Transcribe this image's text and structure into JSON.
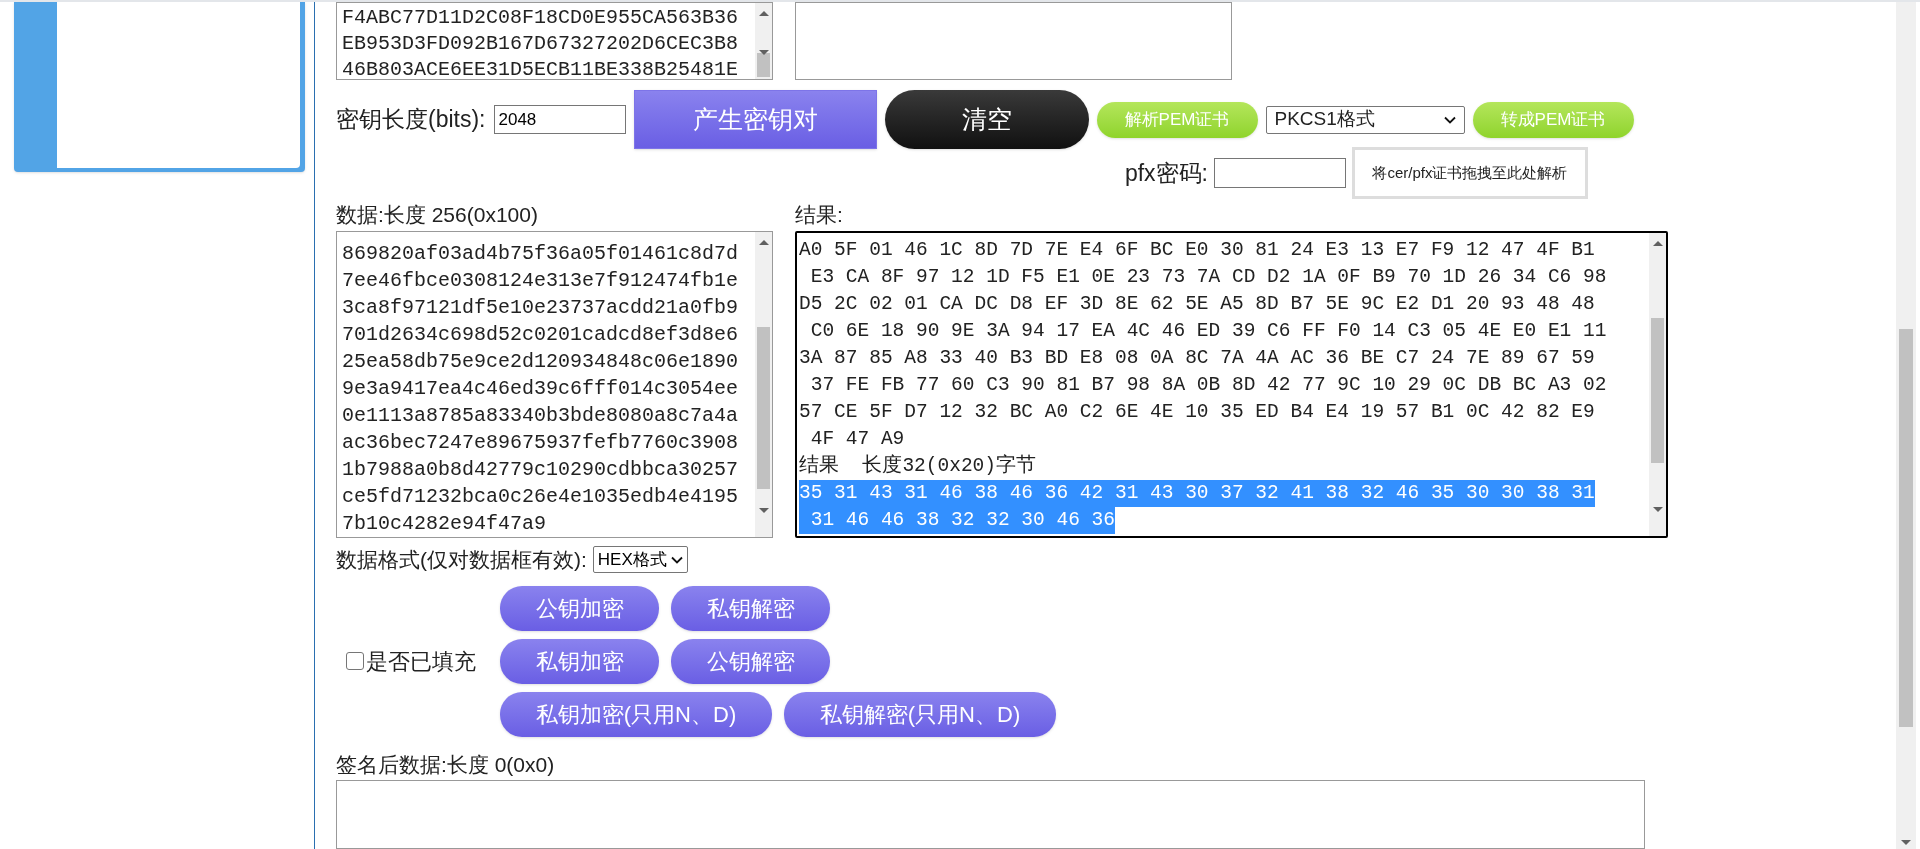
{
  "key_box": {
    "lines": [
      "F4ABC77D11D2C08F18CD0E955CA563B36",
      "EB953D3FD092B167D67327202D6CEC3B8",
      "46B803ACE6EE31D5ECB11BE338B25481E"
    ]
  },
  "key_length": {
    "label": "密钥长度(bits):",
    "value": "2048"
  },
  "toolbar": [
    {
      "kind": "purple",
      "label": "产生密钥对"
    },
    {
      "kind": "dark",
      "label": "清空"
    },
    {
      "kind": "green",
      "label": "解析PEM证书"
    },
    {
      "kind": "select",
      "label": "PKCS1格式"
    },
    {
      "kind": "green",
      "label": "转成PEM证书"
    }
  ],
  "pfx": {
    "label": "pfx密码:",
    "drop_hint": "将cer/pfx证书拖拽至此处解析"
  },
  "data": {
    "label": "数据:长度 256(0x100)",
    "lines": [
      "869820af03ad4b75f36a05f01461c8d7d",
      "7ee46fbce0308124e313e7f912474fb1e",
      "3ca8f97121df5e10e23737acdd21a0fb9",
      "701d2634c698d52c0201cadcd8ef3d8e6",
      "25ea58db75e9ce2d120934848c06e1890",
      "9e3a9417ea4c46ed39c6fff014c3054ee",
      "0e1113a8785a83340b3bde8080a8c7a4a",
      "ac36bec7247e89675937fefb7760c3908",
      "1b7988a0b8d42779c10290cdbbca30257",
      "ce5fd71232bca0c26e4e1035edb4e4195",
      "7b10c4282e94f47a9"
    ]
  },
  "result": {
    "label": "结果:",
    "lines": [
      {
        "text": "A0 5F 01 46 1C 8D 7D 7E E4 6F BC E0 30 81 24 E3 13 E7 F9 12 47 4F B1",
        "selected": false
      },
      {
        "text": " E3 CA 8F 97 12 1D F5 E1 0E 23 73 7A CD D2 1A 0F B9 70 1D 26 34 C6 98",
        "selected": false
      },
      {
        "text": "D5 2C 02 01 CA DC D8 EF 3D 8E 62 5E A5 8D B7 5E 9C E2 D1 20 93 48 48",
        "selected": false
      },
      {
        "text": " C0 6E 18 90 9E 3A 94 17 EA 4C 46 ED 39 C6 FF F0 14 C3 05 4E E0 E1 11",
        "selected": false
      },
      {
        "text": "3A 87 85 A8 33 40 B3 BD E8 08 0A 8C 7A 4A AC 36 BE C7 24 7E 89 67 59",
        "selected": false
      },
      {
        "text": " 37 FE FB 77 60 C3 90 81 B7 98 8A 0B 8D 42 77 9C 10 29 0C DB BC A3 02",
        "selected": false
      },
      {
        "text": "57 CE 5F D7 12 32 BC A0 C2 6E 4E 10 35 ED B4 E4 19 57 B1 0C 42 82 E9",
        "selected": false
      },
      {
        "text": " 4F 47 A9",
        "selected": false
      },
      {
        "text": "结果  长度32(0x20)字节",
        "selected": false
      },
      {
        "text": "35 31 43 31 46 38 46 36 42 31 43 30 37 32 41 38 32 46 35 30 30 38 31",
        "selected": true
      },
      {
        "text": " 31 46 46 38 32 32 30 46 36",
        "selected": true
      }
    ]
  },
  "data_format": {
    "label": "数据格式(仅对数据框有效):",
    "value": "HEX格式"
  },
  "padding": {
    "label": "是否已填充",
    "checked": false
  },
  "actions": [
    [
      "公钥加密",
      "私钥解密"
    ],
    [
      "私钥加密",
      "公钥解密"
    ],
    [
      "私钥加密(只用N、D)",
      "私钥解密(只用N、D)"
    ]
  ],
  "signed": {
    "label": "签名后数据:长度 0(0x0)"
  }
}
